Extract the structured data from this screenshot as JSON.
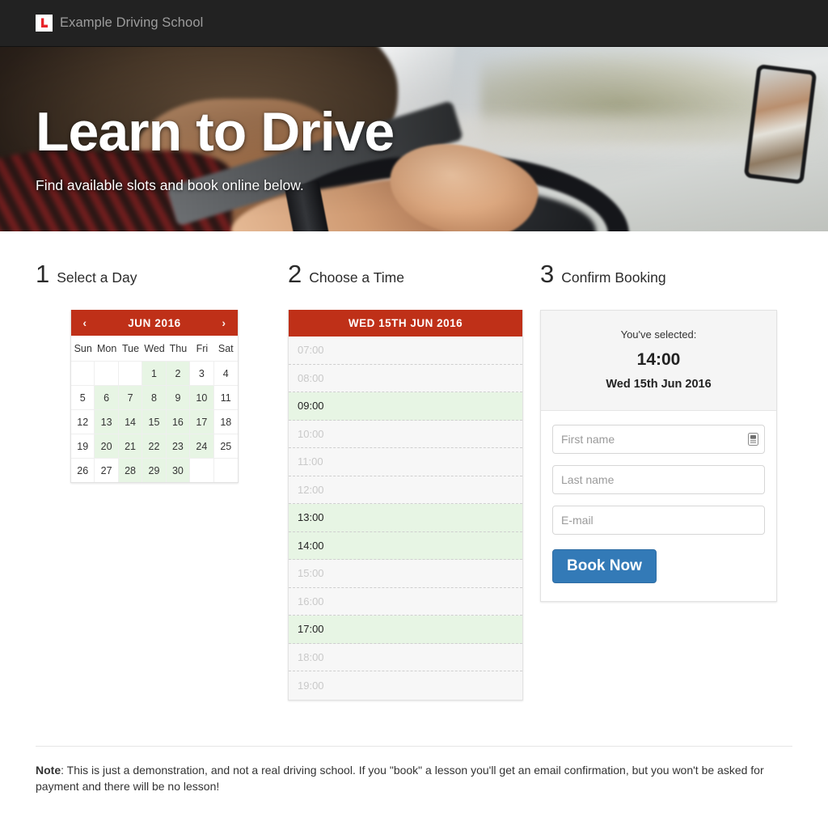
{
  "navbar": {
    "logo_icon": "l-plate-icon",
    "brand": "Example Driving School",
    "background": "#222222",
    "logo_red": "#e8242a"
  },
  "hero": {
    "title": "Learn to Drive",
    "subtitle": "Find available slots and book online below.",
    "image_description": "photo of a learner driver holding a steering wheel, road ahead, rear-view mirror top right"
  },
  "steps": [
    {
      "number": "1",
      "label": "Select a Day"
    },
    {
      "number": "2",
      "label": "Choose a Time"
    },
    {
      "number": "3",
      "label": "Confirm Booking"
    }
  ],
  "calendar": {
    "accent_color": "#BF3018",
    "available_color": "#e7f5e4",
    "prev_icon": "chevron-left-icon",
    "next_icon": "chevron-right-icon",
    "prev_label": "‹",
    "next_label": "›",
    "title": "JUN 2016",
    "weekdays": [
      "Sun",
      "Mon",
      "Tue",
      "Wed",
      "Thu",
      "Fri",
      "Sat"
    ],
    "weeks": [
      [
        {
          "day": "",
          "available": false,
          "empty": true
        },
        {
          "day": "",
          "available": false,
          "empty": true
        },
        {
          "day": "",
          "available": false,
          "empty": true
        },
        {
          "day": "1",
          "available": true
        },
        {
          "day": "2",
          "available": true
        },
        {
          "day": "3",
          "available": false
        },
        {
          "day": "4",
          "available": false
        }
      ],
      [
        {
          "day": "5",
          "available": false
        },
        {
          "day": "6",
          "available": true
        },
        {
          "day": "7",
          "available": true
        },
        {
          "day": "8",
          "available": true
        },
        {
          "day": "9",
          "available": true
        },
        {
          "day": "10",
          "available": true
        },
        {
          "day": "11",
          "available": false
        }
      ],
      [
        {
          "day": "12",
          "available": false
        },
        {
          "day": "13",
          "available": true
        },
        {
          "day": "14",
          "available": true
        },
        {
          "day": "15",
          "available": true
        },
        {
          "day": "16",
          "available": true
        },
        {
          "day": "17",
          "available": true
        },
        {
          "day": "18",
          "available": false
        }
      ],
      [
        {
          "day": "19",
          "available": false
        },
        {
          "day": "20",
          "available": true
        },
        {
          "day": "21",
          "available": true
        },
        {
          "day": "22",
          "available": true
        },
        {
          "day": "23",
          "available": true
        },
        {
          "day": "24",
          "available": true
        },
        {
          "day": "25",
          "available": false
        }
      ],
      [
        {
          "day": "26",
          "available": false
        },
        {
          "day": "27",
          "available": false
        },
        {
          "day": "28",
          "available": true
        },
        {
          "day": "29",
          "available": true
        },
        {
          "day": "30",
          "available": true
        },
        {
          "day": "",
          "available": false,
          "empty": true
        },
        {
          "day": "",
          "available": false,
          "empty": true
        }
      ]
    ]
  },
  "timeslots": {
    "header": "WED 15TH JUN 2016",
    "accent_color": "#BF3018",
    "available_color": "#e7f5e4",
    "slots": [
      {
        "time": "07:00",
        "available": false
      },
      {
        "time": "08:00",
        "available": false
      },
      {
        "time": "09:00",
        "available": true
      },
      {
        "time": "10:00",
        "available": false
      },
      {
        "time": "11:00",
        "available": false
      },
      {
        "time": "12:00",
        "available": false
      },
      {
        "time": "13:00",
        "available": true
      },
      {
        "time": "14:00",
        "available": true
      },
      {
        "time": "15:00",
        "available": false
      },
      {
        "time": "16:00",
        "available": false
      },
      {
        "time": "17:00",
        "available": true
      },
      {
        "time": "18:00",
        "available": false
      },
      {
        "time": "19:00",
        "available": false
      }
    ]
  },
  "confirm": {
    "selected_label": "You've selected:",
    "selected_time": "14:00",
    "selected_date": "Wed 15th Jun 2016",
    "fields": [
      {
        "name": "first-name-field",
        "placeholder": "First name",
        "value": "",
        "autofill_icon": "contact-card-icon"
      },
      {
        "name": "last-name-field",
        "placeholder": "Last name",
        "value": ""
      },
      {
        "name": "email-field",
        "placeholder": "E-mail",
        "value": ""
      }
    ],
    "button_label": "Book Now",
    "button_color": "#337ab7"
  },
  "footer": {
    "note_prefix": "Note",
    "note_text": ": This is just a demonstration, and not a real driving school. If you \"book\" a lesson you'll get an email confirmation, but you won't be asked for payment and there will be no lesson!"
  }
}
